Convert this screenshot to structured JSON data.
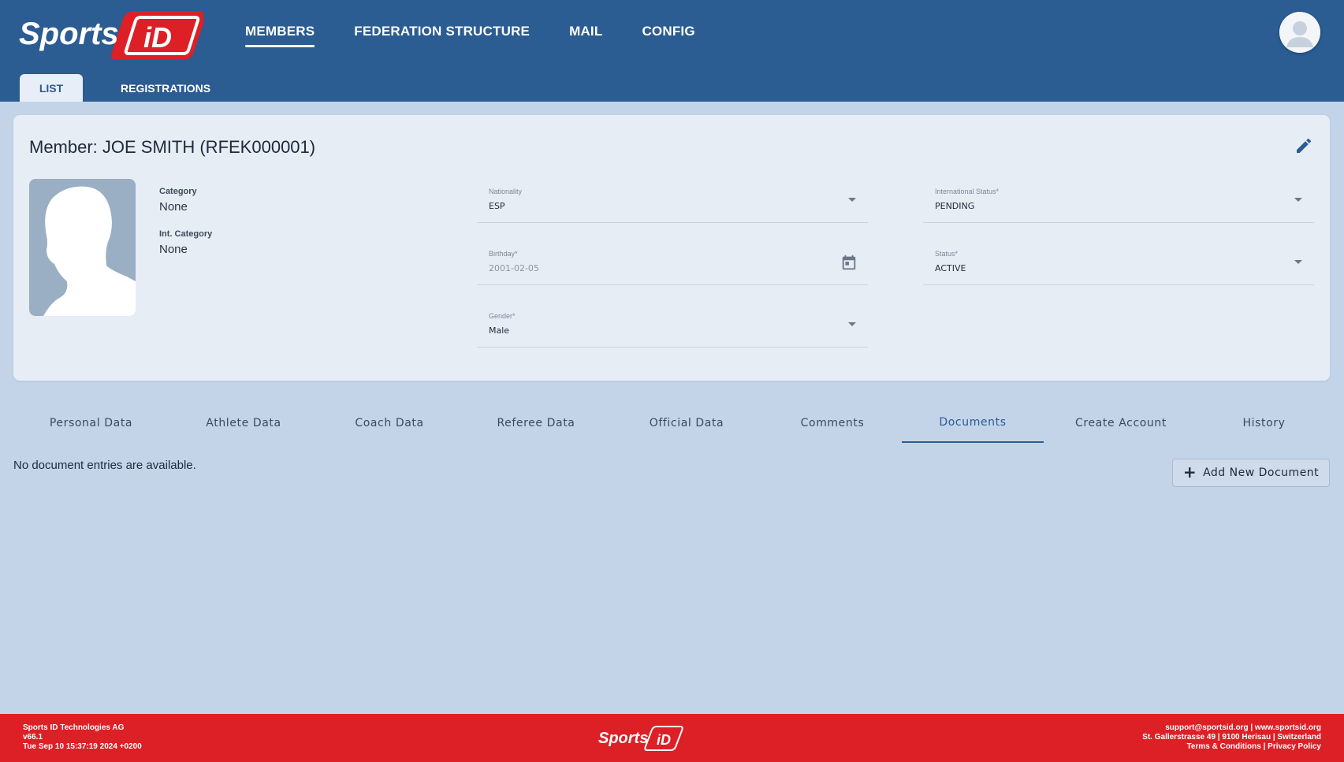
{
  "app": {
    "logo_text": "Sports iD"
  },
  "nav": {
    "items": [
      {
        "label": "MEMBERS",
        "active": true
      },
      {
        "label": "FEDERATION STRUCTURE",
        "active": false
      },
      {
        "label": "MAIL",
        "active": false
      },
      {
        "label": "CONFIG",
        "active": false
      }
    ]
  },
  "subtabs": [
    {
      "label": "LIST",
      "active": true
    },
    {
      "label": "REGISTRATIONS",
      "active": false
    }
  ],
  "member": {
    "title": "Member: JOE SMITH (RFEK000001)",
    "category_label": "Category",
    "category_value": "None",
    "int_category_label": "Int. Category",
    "int_category_value": "None"
  },
  "fields": {
    "nationality": {
      "label": "Nationality",
      "value": "ESP"
    },
    "birthday": {
      "label": "Birthday*",
      "value": "2001-02-05"
    },
    "gender": {
      "label": "Gender*",
      "value": "Male"
    },
    "international_status": {
      "label": "International Status*",
      "value": "PENDING"
    },
    "status": {
      "label": "Status*",
      "value": "ACTIVE"
    }
  },
  "tabs": [
    {
      "label": "Personal Data",
      "active": false
    },
    {
      "label": "Athlete Data",
      "active": false
    },
    {
      "label": "Coach Data",
      "active": false
    },
    {
      "label": "Referee Data",
      "active": false
    },
    {
      "label": "Official Data",
      "active": false
    },
    {
      "label": "Comments",
      "active": false
    },
    {
      "label": "Documents",
      "active": true
    },
    {
      "label": "Create Account",
      "active": false
    },
    {
      "label": "History",
      "active": false
    }
  ],
  "documents": {
    "empty_message": "No document entries are available.",
    "add_button": "Add New Document"
  },
  "footer": {
    "company": "Sports ID Technologies AG",
    "version": "v66.1",
    "timestamp": "Tue Sep 10 15:37:19 2024 +0200",
    "support_email": "support@sportsid.org",
    "website": "www.sportsid.org",
    "address": "St. Gallerstrasse 49 | 9100 Herisau | Switzerland",
    "terms": "Terms & Conditions",
    "privacy": "Privacy Policy"
  },
  "colors": {
    "header": "#2b5c92",
    "background": "#c3d4e9",
    "card": "#e7edf5",
    "footer": "#dd1f26",
    "accent": "#2b5c92"
  },
  "icons": [
    "sportsid-logo",
    "user-avatar-icon",
    "edit-pencil-icon",
    "member-silhouette",
    "dropdown-arrow-icon",
    "calendar-icon",
    "plus-icon"
  ]
}
